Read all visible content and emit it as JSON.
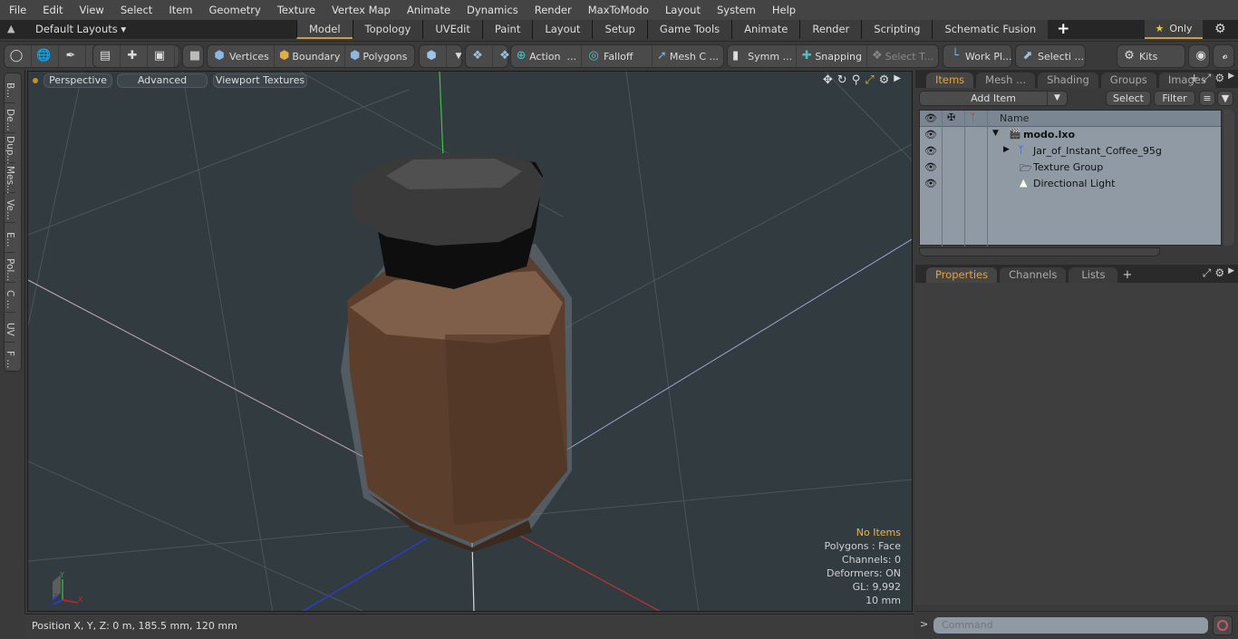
{
  "menu": [
    "File",
    "Edit",
    "View",
    "Select",
    "Item",
    "Geometry",
    "Texture",
    "Vertex Map",
    "Animate",
    "Dynamics",
    "Render",
    "MaxToModo",
    "Layout",
    "System",
    "Help"
  ],
  "layoutbar": {
    "layouts_label": "Default Layouts ▾",
    "tabs": [
      "Model",
      "Topology",
      "UVEdit",
      "Paint",
      "Layout",
      "Setup",
      "Game Tools",
      "Animate",
      "Render",
      "Scripting",
      "Schematic Fusion"
    ],
    "active_tab": "Model",
    "only_label": "Only"
  },
  "toolbar": {
    "vertices": "Vertices",
    "boundary": "Boundary",
    "polygons": "Polygons",
    "action": "Action",
    "falloff": "Falloff",
    "mesh": "Mesh C ...",
    "symm": "Symm ...",
    "snapping": "Snapping",
    "select_t": "Select T...",
    "workplane": "Work Pl...",
    "selecti": "Selecti ...",
    "kits": "Kits"
  },
  "left_tabs": [
    "B...",
    "De...",
    "Dup...",
    "Mes...",
    "Ve...",
    "E...",
    "Pol...",
    "C ...",
    "UV",
    "F ..."
  ],
  "viewport": {
    "view": "Perspective",
    "shading": "Advanced",
    "textures": "Viewport Textures",
    "stats": {
      "items": "No Items",
      "polygons": "Polygons : Face",
      "channels": "Channels: 0",
      "deformers": "Deformers: ON",
      "gl": "GL: 9,992",
      "scale": "10 mm"
    }
  },
  "status": {
    "position": "Position X, Y, Z:   0 m, 185.5 mm, 120 mm"
  },
  "items_panel": {
    "tabs": [
      "Items",
      "Mesh ...",
      "Shading",
      "Groups",
      "Images"
    ],
    "add_item": "Add Item",
    "select": "Select",
    "filter": "Filter",
    "name_col": "Name",
    "tree": [
      {
        "label": "modo.lxo",
        "level": 0
      },
      {
        "label": "Jar_of_Instant_Coffee_95g",
        "level": 1
      },
      {
        "label": "Texture Group",
        "level": 1
      },
      {
        "label": "Directional Light",
        "level": 1
      }
    ]
  },
  "props_panel": {
    "tabs": [
      "Properties",
      "Channels",
      "Lists"
    ]
  },
  "command": {
    "placeholder": "Command"
  }
}
